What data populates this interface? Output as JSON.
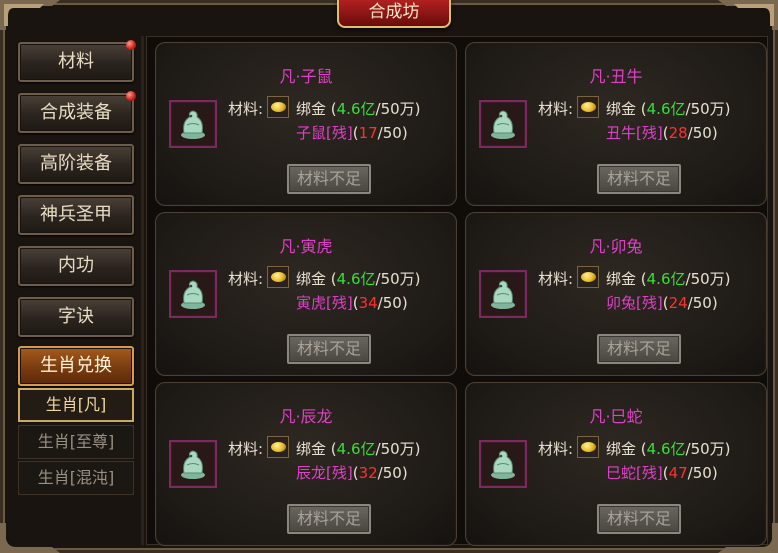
{
  "window": {
    "title": "合成坊"
  },
  "sidebar": {
    "items": [
      {
        "label": "材料",
        "has_dot": true
      },
      {
        "label": "合成装备",
        "has_dot": true
      },
      {
        "label": "高阶装备",
        "has_dot": false
      },
      {
        "label": "神兵圣甲",
        "has_dot": false
      },
      {
        "label": "内功",
        "has_dot": false
      },
      {
        "label": "字诀",
        "has_dot": false
      },
      {
        "label": "生肖兑换",
        "has_dot": false,
        "active": true
      }
    ],
    "subitems": [
      {
        "label": "生肖[凡]",
        "active": true
      },
      {
        "label": "生肖[至尊]",
        "active": false
      },
      {
        "label": "生肖[混沌]",
        "active": false
      }
    ]
  },
  "cards": [
    {
      "title": "凡·子鼠",
      "material_label": "材料:",
      "gold_name": "绑金",
      "gold_have": "4.6亿",
      "gold_need": "50万",
      "shard_name": "子鼠[残]",
      "shard_have": "17",
      "shard_need": "50",
      "button": "材料不足",
      "icon": "rat-jade-icon"
    },
    {
      "title": "凡·丑牛",
      "material_label": "材料:",
      "gold_name": "绑金",
      "gold_have": "4.6亿",
      "gold_need": "50万",
      "shard_name": "丑牛[残]",
      "shard_have": "28",
      "shard_need": "50",
      "button": "材料不足",
      "icon": "ox-jade-icon"
    },
    {
      "title": "凡·寅虎",
      "material_label": "材料:",
      "gold_name": "绑金",
      "gold_have": "4.6亿",
      "gold_need": "50万",
      "shard_name": "寅虎[残]",
      "shard_have": "34",
      "shard_need": "50",
      "button": "材料不足",
      "icon": "tiger-jade-icon"
    },
    {
      "title": "凡·卯兔",
      "material_label": "材料:",
      "gold_name": "绑金",
      "gold_have": "4.6亿",
      "gold_need": "50万",
      "shard_name": "卯兔[残]",
      "shard_have": "24",
      "shard_need": "50",
      "button": "材料不足",
      "icon": "rabbit-jade-icon"
    },
    {
      "title": "凡·辰龙",
      "material_label": "材料:",
      "gold_name": "绑金",
      "gold_have": "4.6亿",
      "gold_need": "50万",
      "shard_name": "辰龙[残]",
      "shard_have": "32",
      "shard_need": "50",
      "button": "材料不足",
      "icon": "dragon-jade-icon"
    },
    {
      "title": "凡·巳蛇",
      "material_label": "材料:",
      "gold_name": "绑金",
      "gold_have": "4.6亿",
      "gold_need": "50万",
      "shard_name": "巳蛇[残]",
      "shard_have": "47",
      "shard_need": "50",
      "button": "材料不足",
      "icon": "snake-jade-icon"
    }
  ],
  "colors": {
    "title": "#e040c8",
    "gold_have": "#38e038",
    "shard_have": "#ff3030",
    "active_tab": "#a45a1c"
  }
}
